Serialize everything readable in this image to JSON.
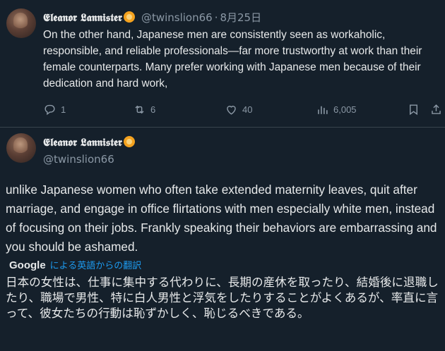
{
  "top_tweet": {
    "author_name": "𝕰𝖑𝖊𝖆𝖓𝖔𝖗 𝕷𝖆𝖓𝖓𝖎𝖘𝖙𝖊𝖗",
    "handle": "@twinslion66",
    "separator": "·",
    "date": "8月25日",
    "text": "On the other hand, Japanese men are consistently seen as workaholic, responsible, and reliable professionals—far more trustworthy at work than their female counterparts. Many prefer working with Japanese men because of their dedication and hard work,",
    "replies": "1",
    "retweets": "6",
    "likes": "40",
    "views": "6,005"
  },
  "main_tweet": {
    "author_name": "𝕰𝖑𝖊𝖆𝖓𝖔𝖗 𝕷𝖆𝖓𝖓𝖎𝖘𝖙𝖊𝖗",
    "handle": "@twinslion66",
    "text": "unlike Japanese women who often take extended maternity leaves, quit after marriage, and engage in office flirtations with men especially white men, instead of focusing on their jobs. Frankly speaking their behaviors are embarrassing and you should be ashamed.",
    "translation_provider": "Google",
    "translation_link": "による英語からの翻訳",
    "translated_text": "日本の女性は、仕事に集中する代わりに、長期の産休を取ったり、結婚後に退職したり、職場で男性、特に白人男性と浮気をしたりすることがよくあるが、率直に言って、彼女たちの行動は恥ずかしく、恥じるべきである。"
  },
  "icons": {
    "badge": "lion-emoji-icon",
    "reply": "reply-icon",
    "retweet": "retweet-icon",
    "like": "heart-icon",
    "views": "analytics-icon",
    "bookmark": "bookmark-icon",
    "share": "share-icon"
  },
  "colors": {
    "background": "#15202b",
    "text": "#e7e9ea",
    "secondary": "#8b98a5",
    "link": "#1d9bf0",
    "divider": "#38444d"
  }
}
